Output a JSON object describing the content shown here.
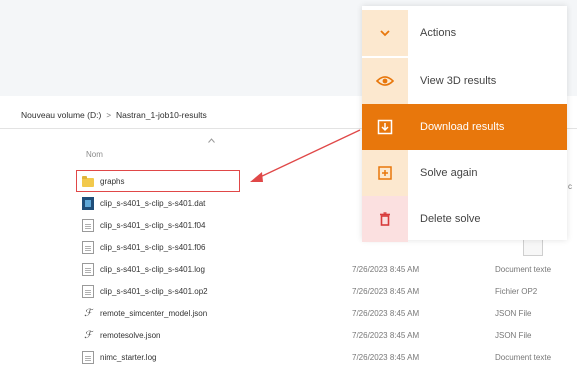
{
  "explorer": {
    "breadcrumb": [
      "Nouveau volume (D:)",
      "Nastran_1-job10-results"
    ],
    "breadcrumb_separator": ">",
    "column_header": "Nom",
    "files": [
      {
        "name": "graphs",
        "icon": "folder-icon",
        "date": "",
        "type": ""
      },
      {
        "name": "clip_s-s401_s-clip_s-s401.dat",
        "icon": "dat-file-icon",
        "date": "",
        "type": ""
      },
      {
        "name": "clip_s-s401_s-clip_s-s401.f04",
        "icon": "document-icon",
        "date": "",
        "type": ""
      },
      {
        "name": "clip_s-s401_s-clip_s-s401.f06",
        "icon": "document-icon",
        "date": "",
        "type": ""
      },
      {
        "name": "clip_s-s401_s-clip_s-s401.log",
        "icon": "document-icon",
        "date": "7/26/2023 8:45 AM",
        "type": "Document texte"
      },
      {
        "name": "clip_s-s401_s-clip_s-s401.op2",
        "icon": "document-icon",
        "date": "7/26/2023 8:45 AM",
        "type": "Fichier OP2"
      },
      {
        "name": "remote_simcenter_model.json",
        "icon": "json-icon",
        "date": "7/26/2023 8:45 AM",
        "type": "JSON File"
      },
      {
        "name": "remotesolve.json",
        "icon": "json-icon",
        "date": "7/26/2023 8:45 AM",
        "type": "JSON File"
      },
      {
        "name": "nimc_starter.log",
        "icon": "document-icon",
        "date": "7/26/2023 8:45 AM",
        "type": "Document texte"
      }
    ],
    "edge_text": "c"
  },
  "menu": {
    "items": [
      {
        "label": "Actions",
        "icon": "chevron-down-icon"
      },
      {
        "label": "View 3D results",
        "icon": "eye-icon"
      },
      {
        "label": "Download results",
        "icon": "download-icon"
      },
      {
        "label": "Solve again",
        "icon": "plus-square-icon"
      },
      {
        "label": "Delete solve",
        "icon": "trash-icon"
      }
    ],
    "active_index": 2
  },
  "colors": {
    "accent": "#e8770c",
    "highlight": "#e04848",
    "peach": "#fce8cf",
    "pink": "#fbe0e0"
  }
}
